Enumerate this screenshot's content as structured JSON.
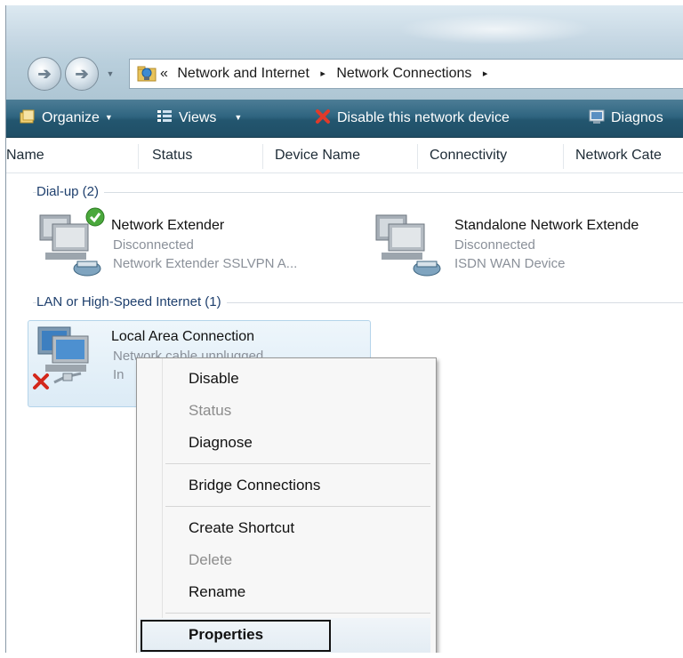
{
  "address": {
    "path": [
      "Network and Internet",
      "Network Connections"
    ],
    "prefix": "«",
    "separator": "▸"
  },
  "toolbar": {
    "organize": "Organize",
    "views": "Views",
    "disable": "Disable this network device",
    "diagnose": "Diagnos"
  },
  "columns": [
    "Name",
    "Status",
    "Device Name",
    "Connectivity",
    "Network Cate"
  ],
  "groups": {
    "dialup": "Dial-up (2)",
    "lan": "LAN or High-Speed Internet (1)"
  },
  "items": {
    "network_extender": {
      "name": "Network Extender",
      "status": "Disconnected",
      "device": "Network Extender SSLVPN A..."
    },
    "standalone": {
      "name": "Standalone Network Extende",
      "status": "Disconnected",
      "device": "ISDN WAN Device"
    },
    "local_area": {
      "name": "Local Area Connection",
      "status": "Network cable unplugged",
      "device": "In"
    }
  },
  "context_menu": {
    "disable": "Disable",
    "status": "Status",
    "diagnose": "Diagnose",
    "bridge": "Bridge Connections",
    "create_shortcut": "Create Shortcut",
    "delete": "Delete",
    "rename": "Rename",
    "properties": "Properties"
  },
  "colors": {
    "toolbar": "#2f6580",
    "highlight_border": "#111111",
    "group_text": "#1e3f6d"
  },
  "icons": [
    "back-arrow-icon",
    "forward-arrow-icon",
    "network-folder-icon",
    "organize-icon",
    "views-icon",
    "disable-x-icon",
    "diagnose-icon",
    "check-icon",
    "error-x-icon",
    "modem-icon"
  ]
}
